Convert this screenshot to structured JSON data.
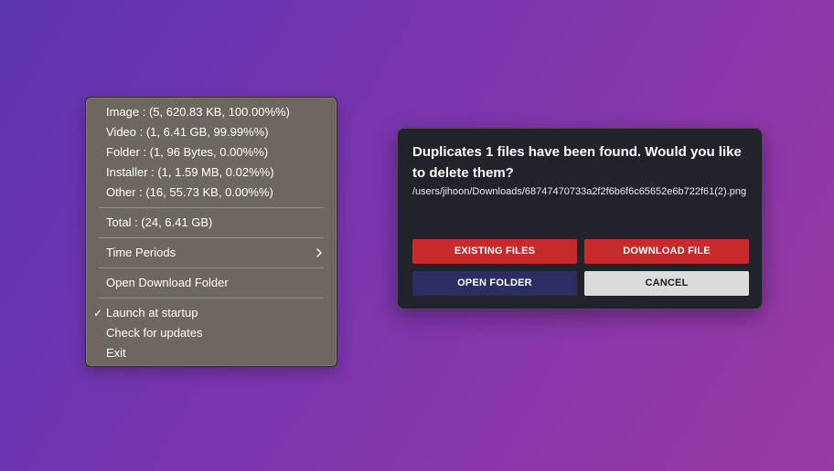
{
  "menu": {
    "stats": [
      "Image : (5, 620.83 KB, 100.00%%)",
      "Video : (1, 6.41 GB, 99.99%%)",
      "Folder : (1, 96 Bytes, 0.00%%)",
      "Installer : (1, 1.59 MB, 0.02%%)",
      "Other : (16, 55.73 KB, 0.00%%)"
    ],
    "total": "Total : (24, 6.41 GB)",
    "time_periods": "Time Periods",
    "open_download_folder": "Open Download Folder",
    "launch_at_startup": "Launch at startup",
    "launch_checked_glyph": "✓",
    "check_for_updates": "Check for updates",
    "exit": "Exit"
  },
  "dialog": {
    "message": "Duplicates 1 files have been found. Would you like to delete them?",
    "path": "/users/jihoon/Downloads/68747470733a2f2f6b6f6c65652e6b722f61(2).png",
    "buttons": {
      "existing_files": "EXISTING FILES",
      "download_file": "DOWNLOAD FILE",
      "open_folder": "OPEN FOLDER",
      "cancel": "CANCEL"
    }
  },
  "colors": {
    "menu_bg": "#6d6760",
    "dialog_bg": "#22222b",
    "red_button": "#c62a2a",
    "navy_button": "#2c2d63",
    "light_button": "#dcdcdc"
  }
}
